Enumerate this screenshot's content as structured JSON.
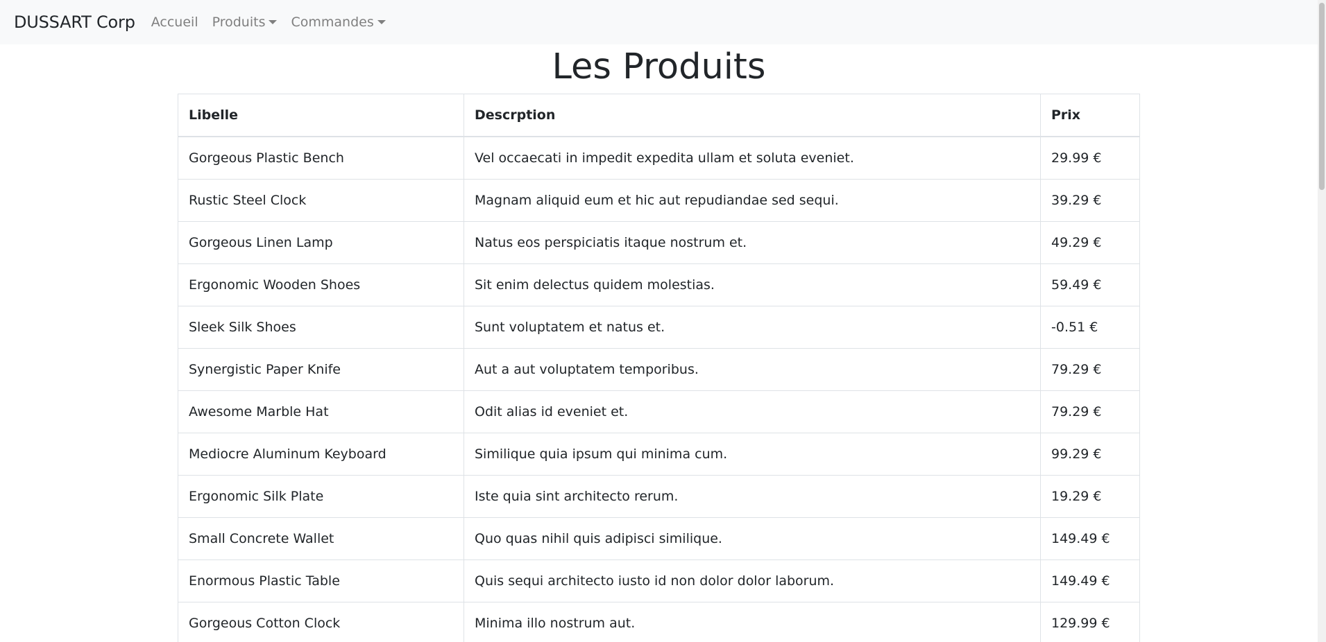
{
  "navbar": {
    "brand": "DUSSART Corp",
    "links": {
      "home": "Accueil",
      "produits": "Produits",
      "commandes": "Commandes"
    }
  },
  "page": {
    "title": "Les Produits"
  },
  "table": {
    "headers": {
      "libelle": "Libelle",
      "description": "Descrption",
      "prix": "Prix"
    },
    "rows": [
      {
        "libelle": "Gorgeous Plastic Bench",
        "description": "Vel occaecati in impedit expedita ullam et soluta eveniet.",
        "prix": "29.99 €"
      },
      {
        "libelle": "Rustic Steel Clock",
        "description": "Magnam aliquid eum et hic aut repudiandae sed sequi.",
        "prix": "39.29 €"
      },
      {
        "libelle": "Gorgeous Linen Lamp",
        "description": "Natus eos perspiciatis itaque nostrum et.",
        "prix": "49.29 €"
      },
      {
        "libelle": "Ergonomic Wooden Shoes",
        "description": "Sit enim delectus quidem molestias.",
        "prix": "59.49 €"
      },
      {
        "libelle": "Sleek Silk Shoes",
        "description": "Sunt voluptatem et natus et.",
        "prix": "-0.51 €"
      },
      {
        "libelle": "Synergistic Paper Knife",
        "description": "Aut a aut voluptatem temporibus.",
        "prix": "79.29 €"
      },
      {
        "libelle": "Awesome Marble Hat",
        "description": "Odit alias id eveniet et.",
        "prix": "79.29 €"
      },
      {
        "libelle": "Mediocre Aluminum Keyboard",
        "description": "Similique quia ipsum qui minima cum.",
        "prix": "99.29 €"
      },
      {
        "libelle": "Ergonomic Silk Plate",
        "description": "Iste quia sint architecto rerum.",
        "prix": "19.29 €"
      },
      {
        "libelle": "Small Concrete Wallet",
        "description": "Quo quas nihil quis adipisci similique.",
        "prix": "149.49 €"
      },
      {
        "libelle": "Enormous Plastic Table",
        "description": "Quis sequi architecto iusto id non dolor dolor laborum.",
        "prix": "149.49 €"
      },
      {
        "libelle": "Gorgeous Cotton Clock",
        "description": "Minima illo nostrum aut.",
        "prix": "129.99 €"
      }
    ]
  }
}
